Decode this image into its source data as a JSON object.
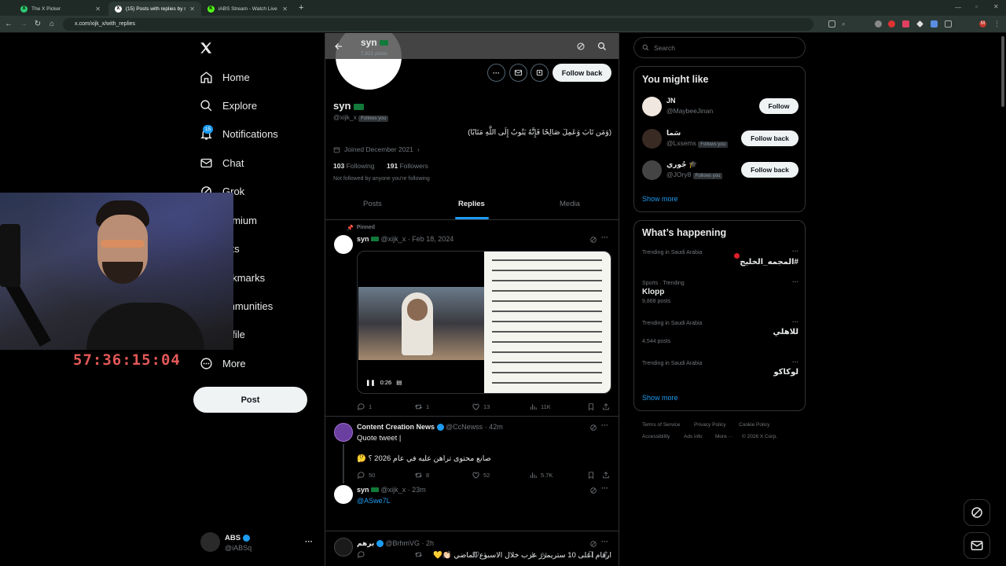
{
  "browser": {
    "tabs": [
      {
        "label": "The X Picker"
      },
      {
        "label": "(15) Posts with replies by syn"
      },
      {
        "label": "iABS Stream - Watch Live on Ki"
      }
    ],
    "new_tab": "+",
    "url": "x.com/xijk_x/with_replies"
  },
  "nav": {
    "items": [
      {
        "label": "Home"
      },
      {
        "label": "Explore"
      },
      {
        "label": "Notifications",
        "badge": "15"
      },
      {
        "label": "Chat"
      },
      {
        "label": "Grok"
      },
      {
        "label": "emium"
      },
      {
        "label": "sts"
      },
      {
        "label": "okmarks"
      },
      {
        "label": "mmunities"
      },
      {
        "label": "ofile"
      },
      {
        "label": "More"
      }
    ],
    "post_button": "Post",
    "account": {
      "name": "ABS",
      "handle": "@iABSq",
      "more": "···"
    }
  },
  "webcam": {
    "timer": "57:36:15:04"
  },
  "profile": {
    "header_name": "syn",
    "header_sub": "7,821 posts",
    "name": "syn",
    "handle": "@xijk_x",
    "follows_you": "Follows you",
    "bio": "(وَمَن تَابَ وَعَمِلَ صَالِحًا فَإِنَّهُ يَتُوبُ إِلَى اللَّهِ مَتَابًا)",
    "joined": "Joined December 2021",
    "following_count": "103",
    "following_label": "Following",
    "followers_count": "191",
    "followers_label": "Followers",
    "not_followed": "Not followed by anyone you're following",
    "follow_back": "Follow back",
    "tabs": [
      "Posts",
      "Replies",
      "Media"
    ]
  },
  "tweets": [
    {
      "pinned": "Pinned",
      "name": "syn",
      "meta": "@xijk_x · Feb 18, 2024",
      "video_time": "0:26",
      "replies": "1",
      "reposts": "1",
      "likes": "13",
      "views": "11K"
    },
    {
      "name": "Content Creation News",
      "meta": "@CcNewss · 42m",
      "text1": "Quote tweet |",
      "text2": "صانع محتوى تراهن عليه في عام 2026 ؟ 🤔",
      "replies": "50",
      "reposts": "8",
      "likes": "52",
      "views": "5.7K"
    },
    {
      "name": "syn",
      "meta": "@xijk_x · 23m",
      "text": "@ASwe7L",
      "replies": "",
      "reposts": "",
      "likes": "1",
      "views": "84"
    },
    {
      "name": "برهم",
      "meta": "@BrhmVG · 2h",
      "text": "ارقام اعلى 10 ستريمرز عرب خلال الاسبوع الماضي 👏🏻💛"
    }
  ],
  "sidebar": {
    "search_placeholder": "Search",
    "you_might_like": "You might like",
    "suggestions": [
      {
        "name": "JN",
        "handle": "@MaybeeJinan",
        "follows_you": "",
        "button": "Follow"
      },
      {
        "name": "سَما",
        "handle": "@Lxsems",
        "follows_you": "Follows you",
        "button": "Follow back"
      },
      {
        "name": "جُوري 🎓",
        "handle": "@JOry8",
        "follows_you": "Follows you",
        "button": "Follow back"
      }
    ],
    "show_more": "Show more",
    "whats_happening": "What’s happening",
    "trends": [
      {
        "context": "Trending in Saudi Arabia",
        "title": "#المجمه_الخليج",
        "posts": ""
      },
      {
        "context": "Sports · Trending",
        "title": "Klopp",
        "posts": "9,868 posts"
      },
      {
        "context": "Trending in Saudi Arabia",
        "title": "للاهلي",
        "posts": "4,544 posts"
      },
      {
        "context": "Trending in Saudi Arabia",
        "title": "لوكاكو",
        "posts": ""
      }
    ],
    "footer": [
      "Terms of Service",
      "Privacy Policy",
      "Cookie Policy",
      "Accessibility",
      "Ads info",
      "More ···",
      "© 2026 X Corp."
    ]
  },
  "colors": {
    "accent": "#1d9bf0",
    "background": "#000000",
    "border": "#2f3336",
    "muted": "#71767b",
    "chrome": "#1f2a26"
  }
}
